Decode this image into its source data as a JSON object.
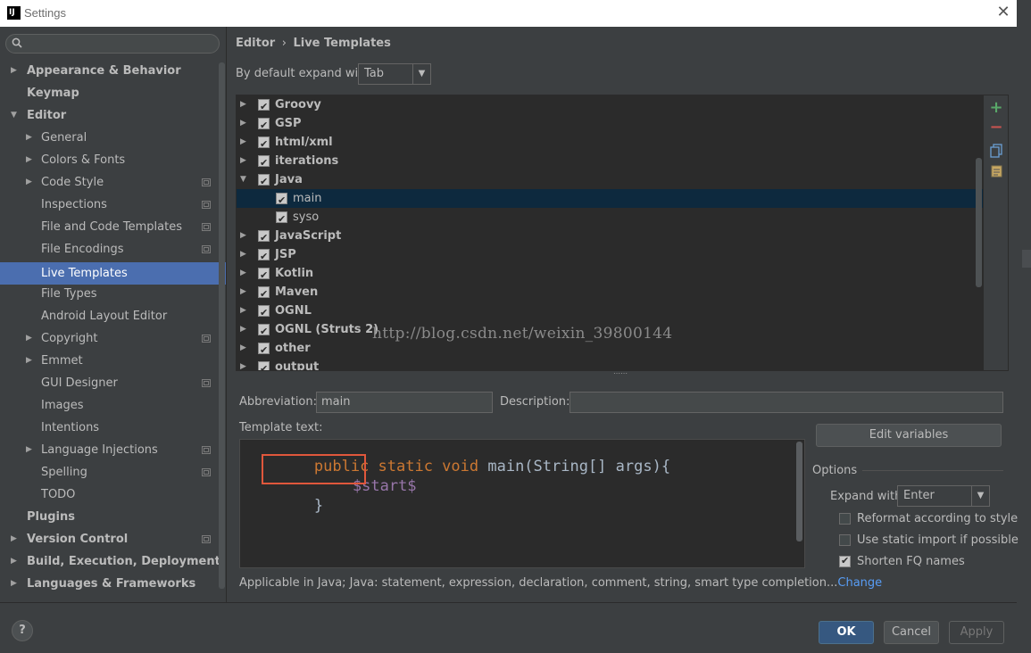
{
  "window": {
    "title": "Settings",
    "app_icon": "intellij-icon"
  },
  "sidebar": {
    "search_placeholder": "",
    "items": [
      {
        "label": "Appearance & Behavior"
      },
      {
        "label": "Keymap"
      },
      {
        "label": "Editor"
      },
      {
        "label": "General"
      },
      {
        "label": "Colors & Fonts"
      },
      {
        "label": "Code Style"
      },
      {
        "label": "Inspections"
      },
      {
        "label": "File and Code Templates"
      },
      {
        "label": "File Encodings"
      },
      {
        "label": "Live Templates"
      },
      {
        "label": "File Types"
      },
      {
        "label": "Android Layout Editor"
      },
      {
        "label": "Copyright"
      },
      {
        "label": "Emmet"
      },
      {
        "label": "GUI Designer"
      },
      {
        "label": "Images"
      },
      {
        "label": "Intentions"
      },
      {
        "label": "Language Injections"
      },
      {
        "label": "Spelling"
      },
      {
        "label": "TODO"
      },
      {
        "label": "Plugins"
      },
      {
        "label": "Version Control"
      },
      {
        "label": "Build, Execution, Deployment"
      },
      {
        "label": "Languages & Frameworks"
      }
    ]
  },
  "breadcrumb": {
    "parent": "Editor",
    "separator": "›",
    "current": "Live Templates"
  },
  "expand_default": {
    "label": "By default expand with",
    "value": "Tab"
  },
  "template_groups": [
    {
      "label": "Groovy"
    },
    {
      "label": "GSP"
    },
    {
      "label": "html/xml"
    },
    {
      "label": "iterations"
    },
    {
      "label": "Java"
    },
    {
      "label": "main"
    },
    {
      "label": "syso"
    },
    {
      "label": "JavaScript"
    },
    {
      "label": "JSP"
    },
    {
      "label": "Kotlin"
    },
    {
      "label": "Maven"
    },
    {
      "label": "OGNL"
    },
    {
      "label": "OGNL (Struts 2)"
    },
    {
      "label": "other"
    },
    {
      "label": "output"
    }
  ],
  "watermark": "http://blog.csdn.net/weixin_39800144",
  "form": {
    "abbreviation_label": "Abbreviation:",
    "abbreviation_value": "main",
    "description_label": "Description:",
    "description_value": "",
    "template_text_label": "Template text:"
  },
  "code": {
    "line1_kw": "public static void",
    "line1_rest": " main(String[] args){",
    "line2_var": "$start$",
    "line3": "}"
  },
  "edit_variables_label": "Edit variables",
  "options": {
    "title": "Options",
    "expand_with_label": "Expand with",
    "expand_with_value": "Enter",
    "reformat_label": "Reformat according to style",
    "reformat_checked": false,
    "static_import_label": "Use static import if possible",
    "static_import_checked": false,
    "shorten_label": "Shorten FQ names",
    "shorten_checked": true
  },
  "applicable": {
    "text": "Applicable in Java; Java: statement, expression, declaration, comment, string, smart type completion...",
    "change_link": "Change"
  },
  "footer": {
    "help_label": "?",
    "ok_label": "OK",
    "cancel_label": "Cancel",
    "apply_label": "Apply"
  },
  "colors": {
    "selection": "#4b6eaf",
    "keyword": "#cc7832",
    "template_var": "#9876aa",
    "highlight_box": "#e0573c",
    "link": "#589df6"
  }
}
